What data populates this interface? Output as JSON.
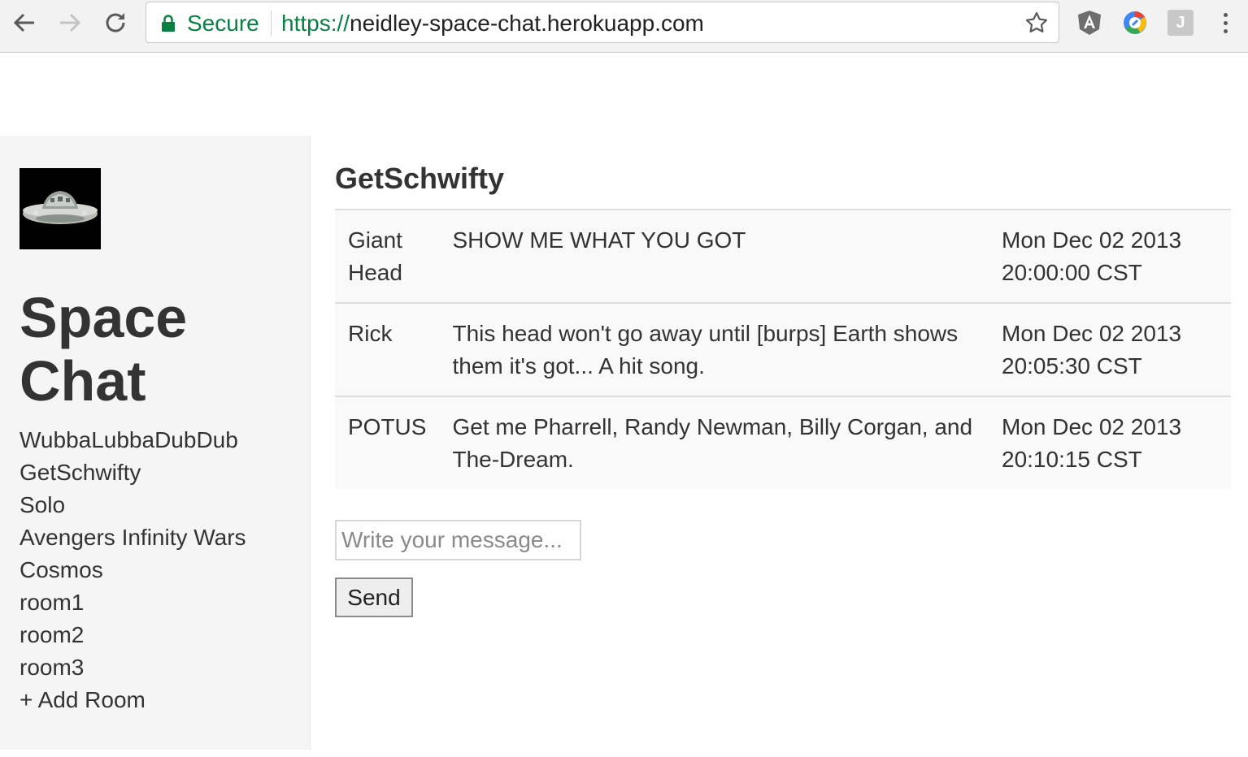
{
  "browser": {
    "secure_label": "Secure",
    "url_scheme": "https://",
    "url_host": "neidley-space-chat.herokuapp.com",
    "extension_j_label": "J"
  },
  "sidebar": {
    "title_line1": "Space",
    "title_line2": "Chat",
    "rooms": [
      "WubbaLubbaDubDub",
      "GetSchwifty",
      "Solo",
      "Avengers Infinity Wars",
      "Cosmos",
      "room1",
      "room2",
      "room3"
    ],
    "add_room_label": "+ Add Room"
  },
  "main": {
    "room_title": "GetSchwifty",
    "messages": [
      {
        "user": "Giant Head",
        "text": "SHOW ME WHAT YOU GOT",
        "time": "Mon Dec 02 2013 20:00:00 CST"
      },
      {
        "user": "Rick",
        "text": "This head won't go away until [burps] Earth shows them it's got... A hit song.",
        "time": "Mon Dec 02 2013 20:05:30 CST"
      },
      {
        "user": "POTUS",
        "text": "Get me Pharrell, Randy Newman, Billy Corgan, and The-Dream.",
        "time": "Mon Dec 02 2013 20:10:15 CST"
      }
    ],
    "input_placeholder": "Write your message...",
    "send_label": "Send"
  }
}
